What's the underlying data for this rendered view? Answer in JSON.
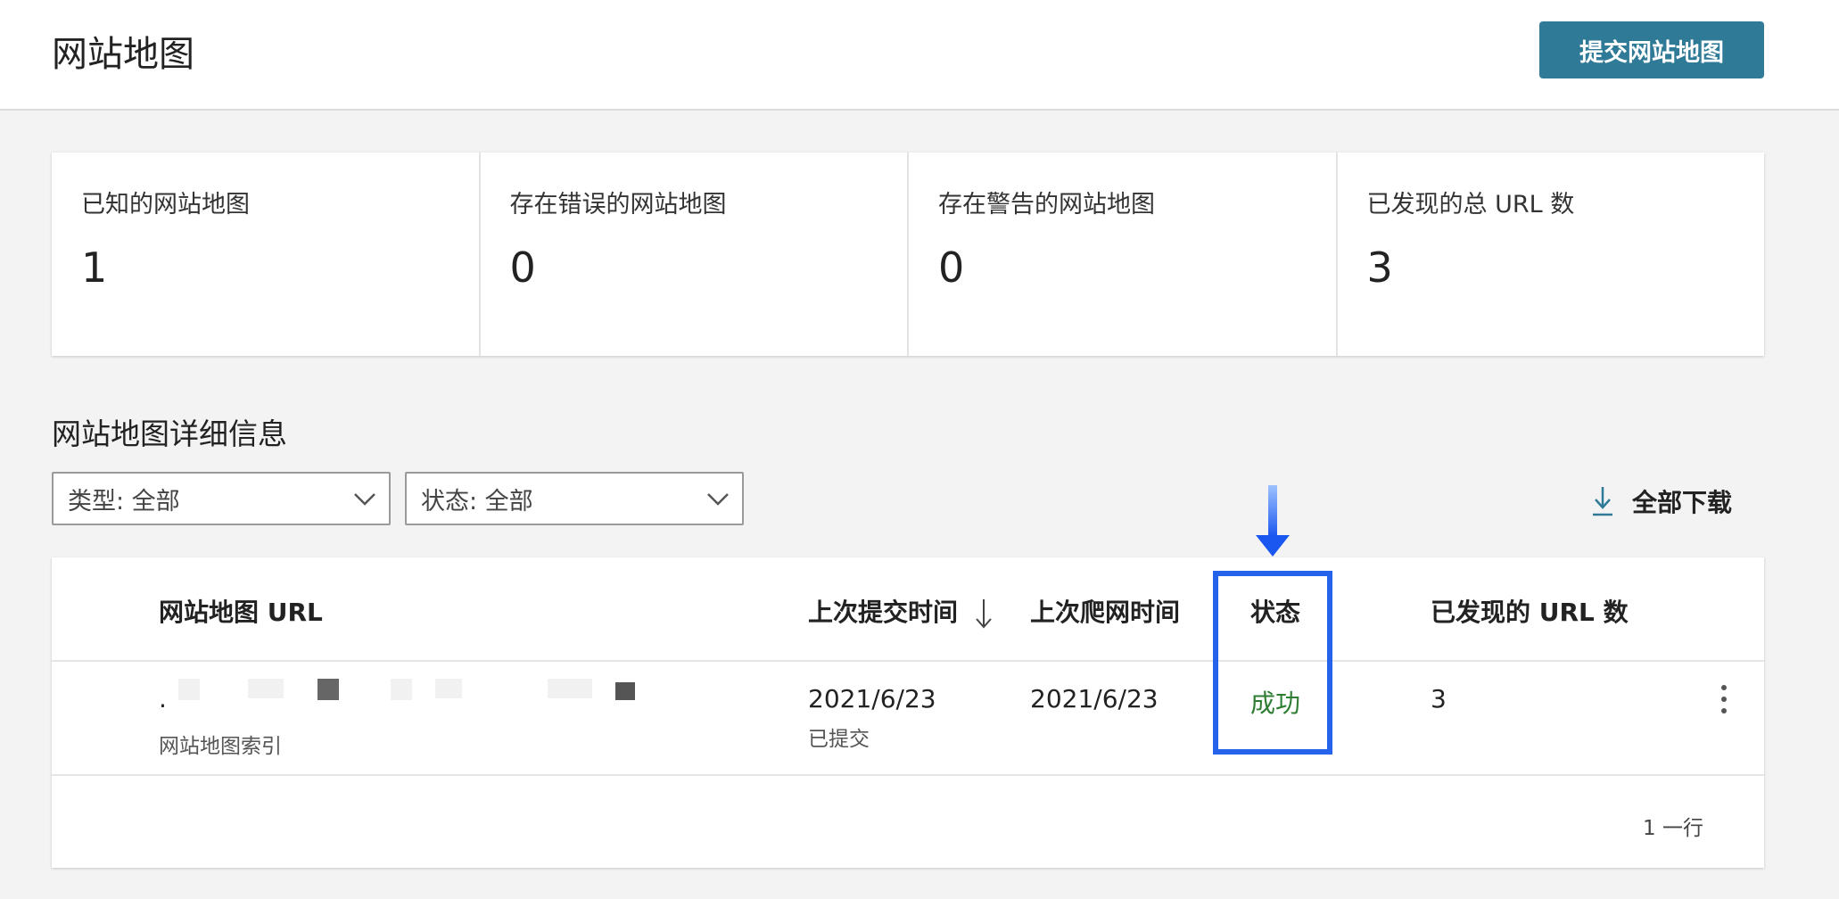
{
  "header": {
    "title": "网站地图",
    "submit_button": "提交网站地图"
  },
  "stats": [
    {
      "label": "已知的网站地图",
      "value": "1"
    },
    {
      "label": "存在错误的网站地图",
      "value": "0"
    },
    {
      "label": "存在警告的网站地图",
      "value": "0"
    },
    {
      "label": "已发现的总 URL 数",
      "value": "3"
    }
  ],
  "details": {
    "title": "网站地图详细信息",
    "filters": [
      {
        "value": "类型: 全部"
      },
      {
        "value": "状态: 全部"
      }
    ],
    "download_label": "全部下载"
  },
  "table": {
    "columns": [
      "网站地图 URL",
      "上次提交时间",
      "上次爬网时间",
      "状态",
      "已发现的 URL 数"
    ],
    "sort_column": "上次提交时间",
    "sort_direction": "descending",
    "rows": [
      {
        "url": ".",
        "type": "网站地图索引",
        "last_submitted": "2021/6/23",
        "submitted_note": "已提交",
        "last_crawled": "2021/6/23",
        "status": "成功",
        "discovered_urls": "3"
      }
    ],
    "row_count": "1 一行"
  },
  "colors": {
    "primary_button": "#2f7a96",
    "success": "#2e7d32",
    "highlight": "#2563eb"
  },
  "icons": [
    "chevron-down-icon",
    "download-icon",
    "sort-arrow-down-icon",
    "more-vert-icon",
    "annotation-arrow-icon"
  ]
}
